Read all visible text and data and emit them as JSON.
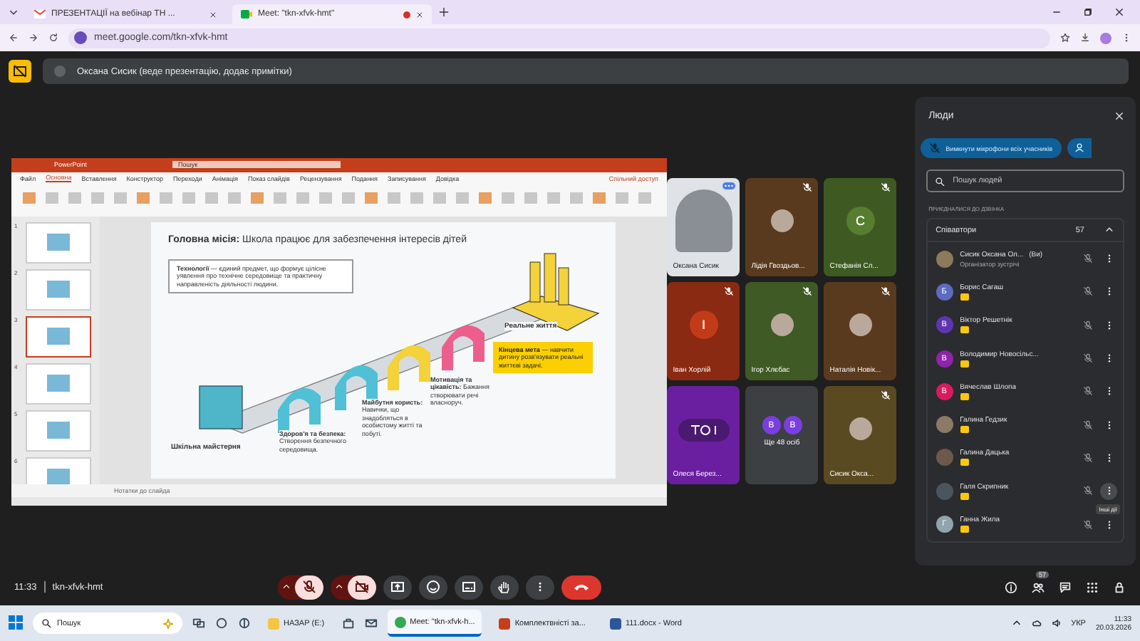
{
  "browser": {
    "tabs": [
      {
        "title": "ПРЕЗЕНТАЦІЇ на вебінар ТН ...",
        "selected": false,
        "kind": "mail"
      },
      {
        "title": "Meet: \"tkn-xfvk-hmt\"",
        "selected": true,
        "kind": "meet"
      }
    ],
    "url": "meet.google.com/tkn-xfvk-hmt"
  },
  "banner": {
    "text": "Оксана Сисик (веде презентацію, додає примітки)"
  },
  "presentation": {
    "app": "PowerPoint",
    "search": "Пошук",
    "ribbon_tabs": [
      {
        "label": "Файл",
        "selected": false
      },
      {
        "label": "Основна",
        "selected": true
      },
      {
        "label": "Вставлення",
        "selected": false
      },
      {
        "label": "Конструктор",
        "selected": false
      },
      {
        "label": "Переходи",
        "selected": false
      },
      {
        "label": "Анімація",
        "selected": false
      },
      {
        "label": "Показ слайдів",
        "selected": false
      },
      {
        "label": "Рецензування",
        "selected": false
      },
      {
        "label": "Подання",
        "selected": false
      },
      {
        "label": "Записування",
        "selected": false
      },
      {
        "label": "Довідка",
        "selected": false
      }
    ],
    "share": "Спільний доступ",
    "thumbnails": [
      {
        "number": "1",
        "selected": false
      },
      {
        "number": "2",
        "selected": false
      },
      {
        "number": "3",
        "selected": true
      },
      {
        "number": "4",
        "selected": false
      },
      {
        "number": "5",
        "selected": false
      },
      {
        "number": "6",
        "selected": false
      }
    ],
    "slide": {
      "title": "**Головна місія:** Школа працює для забезпечення інтересів дітей",
      "definition": "**Технології** — єдиний предмет, що формує цілісне уявлення про технічне середовище та практичну направленість діяльності людини.",
      "workshop": "Шкільна майстерня",
      "health": "**Здоров'я та безпека:** Створення безпечного середовища.",
      "future": "**Майбутня користь:** Навички, що знадобляться в особистому житті та побуті.",
      "motivation": "**Мотивація та цікавість:** Бажання створювати речі власноруч.",
      "real_life": "Реальне життя",
      "goal": "**Кінцева мета** — навчити дитину розв'язувати реальні життєві задачі."
    },
    "notes": "Нотатки до слайда"
  },
  "tiles": [
    {
      "name": "Оксана Сисик",
      "kind": "video",
      "muted": false,
      "color": "#dfe3e8"
    },
    {
      "name": "Лідія Гвоздьов...",
      "kind": "photo",
      "muted": true,
      "color": "#5a3a1e"
    },
    {
      "name": "Стефанія Сл...",
      "kind": "letter",
      "letter": "С",
      "muted": true,
      "color": "#3e5a22"
    },
    {
      "name": "Іван Хорлій",
      "kind": "letter",
      "letter": "І",
      "muted": true,
      "color": "#8a2a12"
    },
    {
      "name": "Ігор Хлєбас",
      "kind": "photo",
      "muted": true,
      "color": "#3f5a25"
    },
    {
      "name": "Наталія Новік...",
      "kind": "photo",
      "muted": true,
      "color": "#5a3a1e"
    },
    {
      "name": "Олеся Берез...",
      "kind": "audio",
      "muted": false,
      "color": "#6a1fa0"
    },
    {
      "name": "Ще 48 осіб",
      "kind": "group",
      "letters": [
        "В",
        "В"
      ],
      "muted": false,
      "color": "#3c4043"
    },
    {
      "name": "Сисик Окса...",
      "kind": "photo",
      "muted": true,
      "color": "#5a4a22"
    }
  ],
  "people": {
    "title": "Люди",
    "mute_all": "Вимкнути мікрофони всіх учасників",
    "search": {
      "placeholder": "Пошук людей"
    },
    "section": "ПРИЄДНАЛИСЯ ДО ДЗВІНКА",
    "group": {
      "label": "Співавтори",
      "count": "57",
      "expanded": true
    },
    "members": [
      {
        "name": "Сисик Оксана Ол...",
        "tag": "(Ви)",
        "subtitle": "Організатор зустрічі",
        "kind": "photo",
        "badge": false,
        "color": "#8d7a5a"
      },
      {
        "name": "Борис Сагаш",
        "kind": "letter",
        "letter": "Б",
        "badge": true,
        "color": "#5c6bc0"
      },
      {
        "name": "Віктор Решетнік",
        "kind": "letter",
        "letter": "В",
        "badge": true,
        "color": "#5e35b1"
      },
      {
        "name": "Володимир Новосільс...",
        "kind": "letter",
        "letter": "В",
        "badge": true,
        "color": "#8e24aa"
      },
      {
        "name": "Вячеслав Шлопа",
        "kind": "letter",
        "letter": "В",
        "badge": true,
        "color": "#d81b60"
      },
      {
        "name": "Галина Гедзик",
        "kind": "photo",
        "badge": true,
        "color": "#8a7a66"
      },
      {
        "name": "Галина Дацька",
        "kind": "photo",
        "badge": true,
        "color": "#6b5a4a"
      },
      {
        "name": "Галя Скрипник",
        "kind": "photo",
        "badge": true,
        "color": "#4a5560",
        "tooltip": "Інші дії"
      },
      {
        "name": "Ганна Жила",
        "kind": "letter",
        "letter": "Г",
        "badge": true,
        "color": "#90a4ae"
      }
    ]
  },
  "call": {
    "time": "11:33",
    "code": "tkn-xfvk-hmt",
    "controls": [
      {
        "kind": "mic",
        "on": false
      },
      {
        "kind": "camera",
        "on": false
      },
      {
        "kind": "present"
      },
      {
        "kind": "emoji"
      },
      {
        "kind": "captions"
      },
      {
        "kind": "hand"
      },
      {
        "kind": "more"
      },
      {
        "kind": "end"
      }
    ],
    "people_count": "57"
  },
  "taskbar": {
    "search": "Пошук",
    "apps": [
      {
        "label": "НАЗАР (E:)",
        "kind": "folder",
        "selected": false
      },
      {
        "label": "Meet: \"tkn-xfvk-h...",
        "kind": "chrome",
        "selected": true
      },
      {
        "label": "Комплектвністі за...",
        "kind": "ppt",
        "selected": false
      },
      {
        "label": "111.docx - Word",
        "kind": "word",
        "selected": false
      }
    ],
    "language": "УКР",
    "time": "11:33",
    "date": "20.03.2026"
  }
}
